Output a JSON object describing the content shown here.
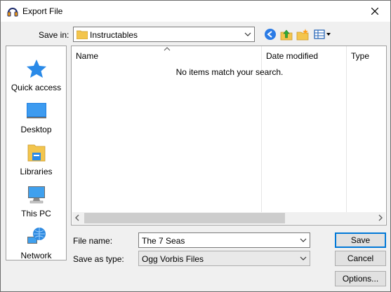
{
  "window": {
    "title": "Export File"
  },
  "toolbar": {
    "save_in_label": "Save in:",
    "save_in_value": "Instructables"
  },
  "places": [
    {
      "label": "Quick access"
    },
    {
      "label": "Desktop"
    },
    {
      "label": "Libraries"
    },
    {
      "label": "This PC"
    },
    {
      "label": "Network"
    }
  ],
  "filelist": {
    "columns": [
      "Name",
      "Date modified",
      "Type"
    ],
    "empty_message": "No items match your search."
  },
  "form": {
    "file_name_label": "File name:",
    "file_name_value": "The 7 Seas",
    "save_type_label": "Save as type:",
    "save_type_value": "Ogg Vorbis Files"
  },
  "buttons": {
    "save": "Save",
    "cancel": "Cancel",
    "options": "Options..."
  },
  "colors": {
    "accent": "#0078d7",
    "folder": "#f3c54d",
    "window_bg": "#f0f0f0"
  }
}
